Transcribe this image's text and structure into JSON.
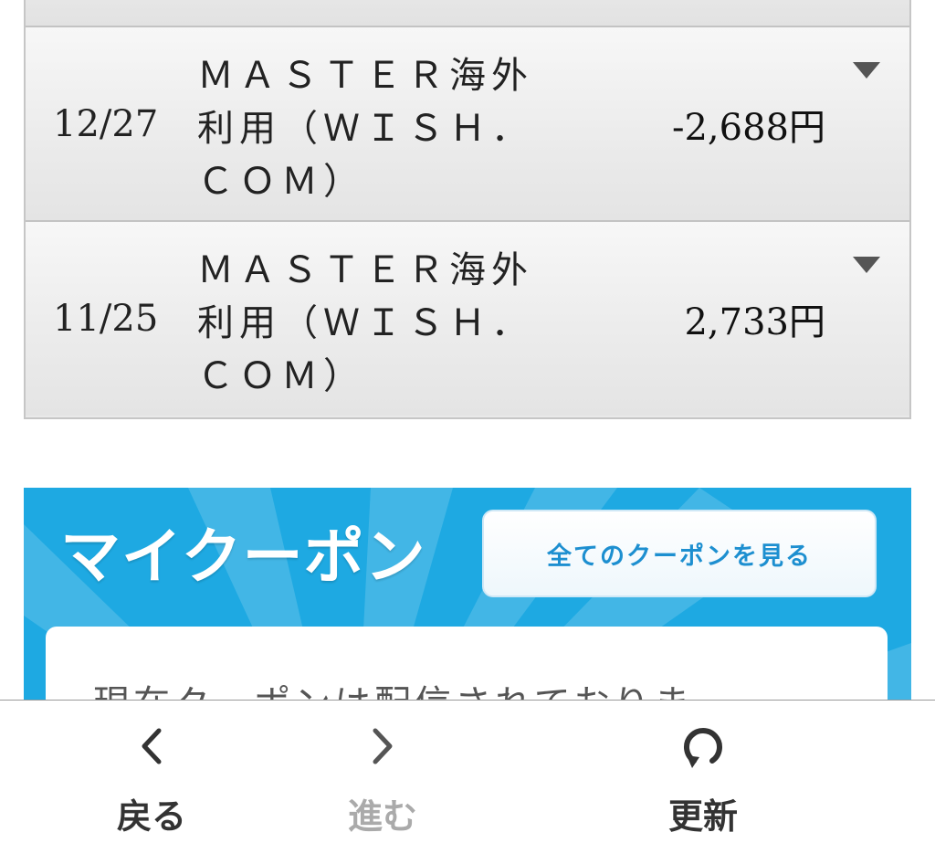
{
  "transactions": [
    {
      "date": "12/27",
      "description": "ＭＡＳＴＥＲ海外利用（ＷＩＳＨ．ＣＯＭ）",
      "amount": "-2,688円"
    },
    {
      "date": "11/25",
      "description": "ＭＡＳＴＥＲ海外利用（ＷＩＳＨ．ＣＯＭ）",
      "amount": "2,733円"
    }
  ],
  "coupon": {
    "title": "マイクーポン",
    "view_all_label": "全てのクーポンを見る",
    "message": "現在クーポンは配信されておりま",
    "colors": {
      "background": "#1ea9e2",
      "button_text": "#1d8fd0"
    }
  },
  "nav": {
    "back_label": "戻る",
    "forward_label": "進む",
    "reload_label": "更新",
    "back_icon": "chevron-left-icon",
    "forward_icon": "chevron-right-icon",
    "reload_icon": "reload-icon"
  }
}
